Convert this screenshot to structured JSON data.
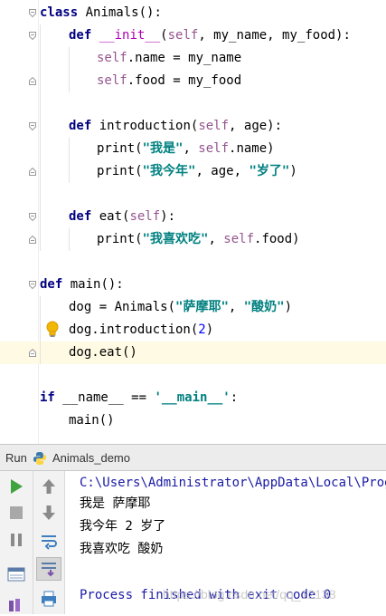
{
  "editor": {
    "lines": [
      {
        "id": "l1",
        "parts": [
          [
            "kw",
            "class"
          ],
          [
            "",
            ""
          ],
          [
            "",
            " Animals():"
          ]
        ]
      },
      {
        "id": "l2",
        "parts": [
          [
            "kw",
            "def"
          ],
          [
            "",
            " "
          ],
          [
            "magic",
            "__init__"
          ],
          [
            "",
            "("
          ],
          [
            "selfk",
            "self"
          ],
          [
            "",
            ", my_name, my_food):"
          ]
        ]
      },
      {
        "id": "l3",
        "parts": [
          [
            "selfk",
            "self"
          ],
          [
            "",
            ".name = my_name"
          ]
        ]
      },
      {
        "id": "l4",
        "parts": [
          [
            "selfk",
            "self"
          ],
          [
            "",
            ".food = my_food"
          ]
        ]
      },
      {
        "id": "l5",
        "parts": [
          [
            "kw",
            "def"
          ],
          [
            "",
            " introduction("
          ],
          [
            "selfk",
            "self"
          ],
          [
            "",
            ", age):"
          ]
        ]
      },
      {
        "id": "l6",
        "parts": [
          [
            "",
            "print("
          ],
          [
            "str",
            "\"我是\""
          ],
          [
            "",
            ", "
          ],
          [
            "selfk",
            "self"
          ],
          [
            "",
            ".name)"
          ]
        ]
      },
      {
        "id": "l7",
        "parts": [
          [
            "",
            "print("
          ],
          [
            "str",
            "\"我今年\""
          ],
          [
            "",
            ", age, "
          ],
          [
            "str",
            "\"岁了\""
          ],
          [
            "",
            ")"
          ]
        ]
      },
      {
        "id": "l8",
        "parts": [
          [
            "kw",
            "def"
          ],
          [
            "",
            " eat("
          ],
          [
            "selfk",
            "self"
          ],
          [
            "",
            "):"
          ]
        ]
      },
      {
        "id": "l9",
        "parts": [
          [
            "",
            "print("
          ],
          [
            "str",
            "\"我喜欢吃\""
          ],
          [
            "",
            ", "
          ],
          [
            "selfk",
            "self"
          ],
          [
            "",
            ".food)"
          ]
        ]
      },
      {
        "id": "l10",
        "parts": [
          [
            "kw",
            "def"
          ],
          [
            "",
            " main():"
          ]
        ]
      },
      {
        "id": "l11",
        "parts": [
          [
            "",
            "dog = Animals("
          ],
          [
            "str",
            "\"萨摩耶\""
          ],
          [
            "",
            ", "
          ],
          [
            "str",
            "\"酸奶\""
          ],
          [
            "",
            ")"
          ]
        ]
      },
      {
        "id": "l12",
        "parts": [
          [
            "",
            "dog.introduction("
          ],
          [
            "num",
            "2"
          ],
          [
            "",
            ")"
          ]
        ]
      },
      {
        "id": "l13",
        "parts": [
          [
            "",
            "dog.eat()"
          ]
        ]
      },
      {
        "id": "l14",
        "parts": [
          [
            "kw",
            "if"
          ],
          [
            "",
            " __name__ == "
          ],
          [
            "str",
            "'__main__'"
          ],
          [
            "",
            ":"
          ]
        ]
      },
      {
        "id": "l15",
        "parts": [
          [
            "",
            "main()"
          ]
        ]
      }
    ]
  },
  "run_panel": {
    "run_label": "Run",
    "config_name": "Animals_demo",
    "console": {
      "command": "C:\\Users\\Administrator\\AppData\\Local\\Progra",
      "output": [
        "我是 萨摩耶",
        "我今年 2 岁了",
        "我喜欢吃 酸奶"
      ],
      "exit_message": "Process finished with exit code 0"
    },
    "watermark": "https://blog.csdn.net/qq_12138"
  },
  "colors": {
    "keyword": "#000080",
    "self": "#94558d",
    "magic": "#b200b2",
    "string": "#008080",
    "number": "#0000ff",
    "current_line": "#fffae3"
  }
}
